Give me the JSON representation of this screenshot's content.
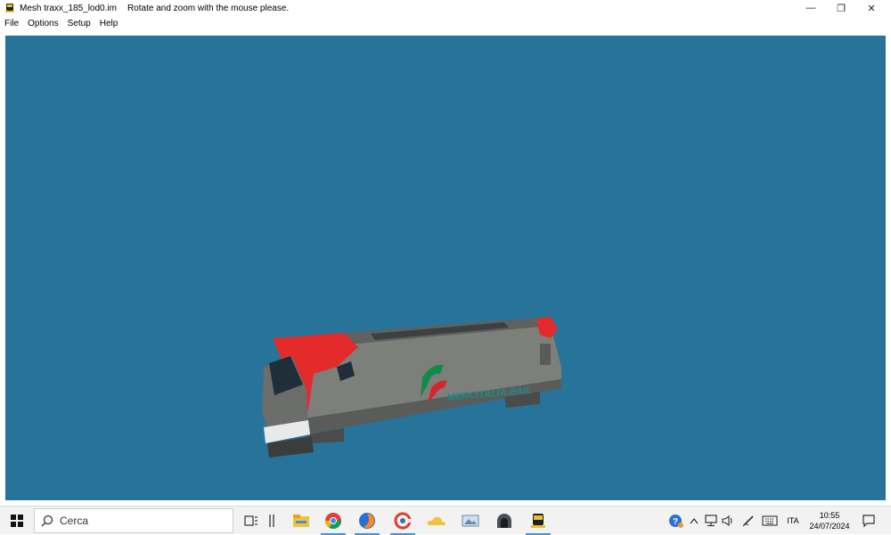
{
  "window": {
    "title": "Mesh traxx_185_lod0.im",
    "hint": "Rotate and zoom with the mouse please.",
    "minimize_glyph": "—",
    "maximize_glyph": "❐",
    "close_glyph": "✕"
  },
  "menu": {
    "items": [
      "File",
      "Options",
      "Setup",
      "Help"
    ]
  },
  "viewport": {
    "background": "#28739a",
    "model": {
      "livery_text": "MERCITALIA RAIL",
      "body_color": "#7d7f7a",
      "accent_color": "#e32b2b",
      "logo_green": "#138a4a",
      "logo_red": "#d6262b",
      "lettering_color": "#1f8a8a"
    }
  },
  "taskbar": {
    "search_placeholder": "Cerca",
    "language": "ITA",
    "time": "10:55",
    "date": "24/07/2024",
    "apps": [
      "task-view-icon",
      "widgets-icon",
      "file-explorer-icon",
      "chrome-icon",
      "firefox-icon",
      "ccleaner-icon",
      "onedrive-icon",
      "photos-icon",
      "tunnel-app-icon",
      "train-app-icon"
    ],
    "tray": [
      "help-icon",
      "chevron-up-icon",
      "network-icon",
      "volume-icon",
      "pen-icon",
      "keyboard-icon"
    ]
  }
}
